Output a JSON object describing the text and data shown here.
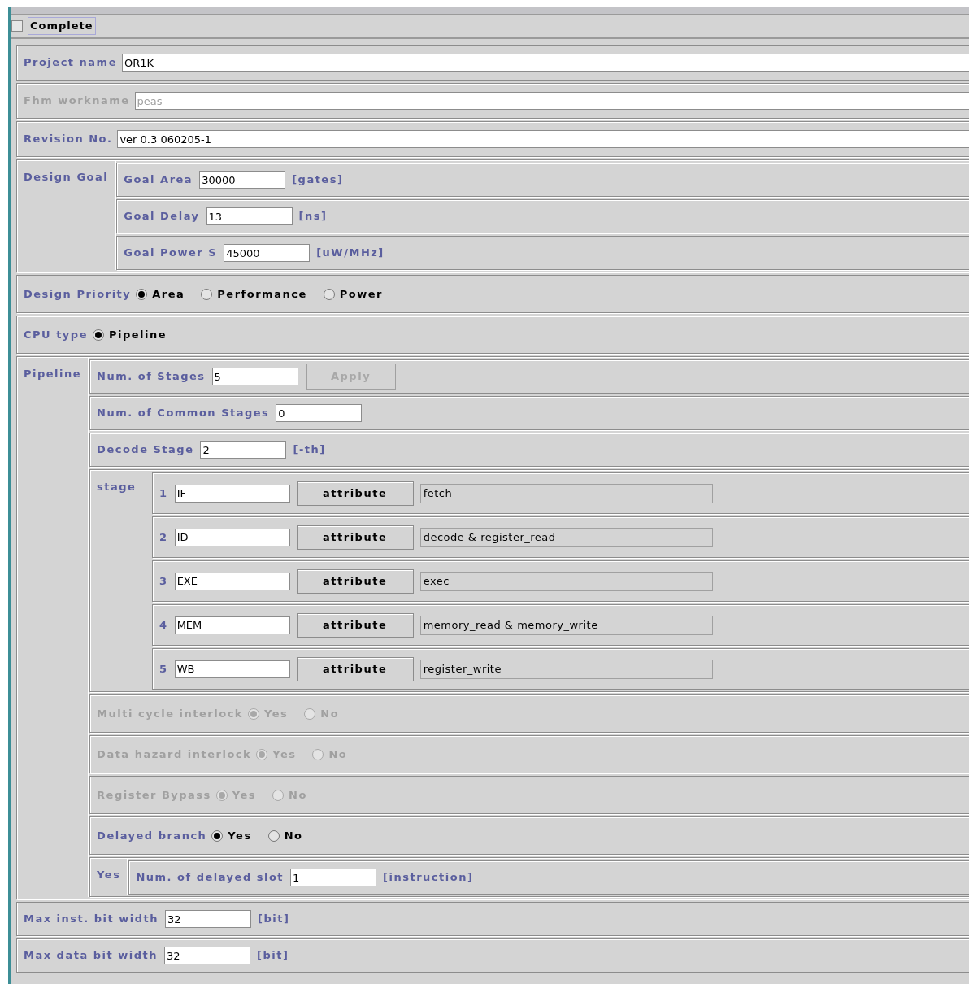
{
  "complete": {
    "label": "Complete",
    "checked": false
  },
  "rows": [
    {
      "kind": "text",
      "label": "Project name",
      "value": "OR1K",
      "disabled": false
    },
    {
      "kind": "text",
      "label": "Fhm workname",
      "value": "peas",
      "disabled": true
    },
    {
      "kind": "text",
      "label": "Revision No.",
      "value": "ver 0.3 060205-1",
      "disabled": false
    },
    {
      "kind": "group",
      "label": "Design Goal",
      "rows": [
        {
          "kind": "number",
          "label": "Goal Area",
          "value": "30000",
          "unit": "[gates]",
          "disabled": false
        },
        {
          "kind": "number",
          "label": "Goal Delay",
          "value": "13",
          "unit": "[ns]",
          "disabled": false
        },
        {
          "kind": "number",
          "label": "Goal Power S",
          "value": "45000",
          "unit": "[uW/MHz]",
          "disabled": false
        }
      ]
    },
    {
      "kind": "radio",
      "label": "Design Priority",
      "disabled": false,
      "options": [
        {
          "label": "Area",
          "selected": true
        },
        {
          "label": "Performance",
          "selected": false
        },
        {
          "label": "Power",
          "selected": false
        }
      ]
    },
    {
      "kind": "radio",
      "label": "CPU type",
      "disabled": false,
      "options": [
        {
          "label": "Pipeline",
          "selected": true
        }
      ]
    },
    {
      "kind": "group",
      "label": "Pipeline",
      "rows": [
        {
          "kind": "number",
          "label": "Num. of Stages",
          "value": "5",
          "disabled": false,
          "button": {
            "label": "Apply",
            "disabled": true
          }
        },
        {
          "kind": "number",
          "label": "Num. of Common Stages",
          "value": "0",
          "disabled": false
        },
        {
          "kind": "number",
          "label": "Decode Stage",
          "value": "2",
          "unit": "[-th]",
          "disabled": false
        },
        {
          "kind": "stages",
          "label": "stage",
          "items": [
            {
              "number": "1",
              "name": "IF",
              "button": "attribute",
              "attribute": "fetch"
            },
            {
              "number": "2",
              "name": "ID",
              "button": "attribute",
              "attribute": "decode & register_read"
            },
            {
              "number": "3",
              "name": "EXE",
              "button": "attribute",
              "attribute": "exec"
            },
            {
              "number": "4",
              "name": "MEM",
              "button": "attribute",
              "attribute": "memory_read & memory_write"
            },
            {
              "number": "5",
              "name": "WB",
              "button": "attribute",
              "attribute": "register_write"
            }
          ]
        },
        {
          "kind": "radio",
          "label": "Multi cycle interlock",
          "disabled": true,
          "options": [
            {
              "label": "Yes",
              "selected": true
            },
            {
              "label": "No",
              "selected": false
            }
          ]
        },
        {
          "kind": "radio",
          "label": "Data hazard interlock",
          "disabled": true,
          "options": [
            {
              "label": "Yes",
              "selected": true
            },
            {
              "label": "No",
              "selected": false
            }
          ]
        },
        {
          "kind": "radio",
          "label": "Register Bypass",
          "disabled": true,
          "options": [
            {
              "label": "Yes",
              "selected": true
            },
            {
              "label": "No",
              "selected": false
            }
          ]
        },
        {
          "kind": "radio",
          "label": "Delayed branch",
          "disabled": false,
          "options": [
            {
              "label": "Yes",
              "selected": true
            },
            {
              "label": "No",
              "selected": false
            }
          ]
        },
        {
          "kind": "group",
          "label": "Yes",
          "rows": [
            {
              "kind": "number",
              "label": "Num. of delayed slot",
              "value": "1",
              "unit": "[instruction]",
              "disabled": false
            }
          ]
        }
      ]
    },
    {
      "kind": "number",
      "label": "Max inst. bit width",
      "value": "32",
      "unit": "[bit]",
      "disabled": false
    },
    {
      "kind": "number",
      "label": "Max data bit width",
      "value": "32",
      "unit": "[bit]",
      "disabled": false
    }
  ]
}
